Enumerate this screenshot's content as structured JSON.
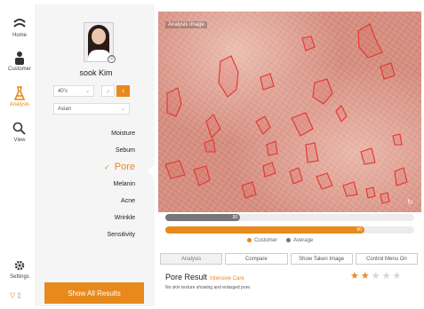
{
  "nav": {
    "items": [
      {
        "label": "Home",
        "icon": "home-icon"
      },
      {
        "label": "Customer",
        "icon": "person-icon"
      },
      {
        "label": "Analysis",
        "icon": "flask-icon",
        "active": true
      },
      {
        "label": "View",
        "icon": "magnifier-icon"
      }
    ],
    "settings_label": "Settings"
  },
  "profile": {
    "name": "sook Kim",
    "age": "40's",
    "ethnicity": "Asian",
    "gender_selected": "female"
  },
  "categories": [
    "Moisture",
    "Sebum",
    "Pore",
    "Melanin",
    "Acne",
    "Wrinkle",
    "Sensitivity"
  ],
  "active_category": "Pore",
  "show_all_label": "Show All Results",
  "image_label": "Analysis Image",
  "scores": {
    "average": 30,
    "customer": 80
  },
  "legend": {
    "customer": "Customer",
    "average": "Average"
  },
  "buttons": [
    "Analysis",
    "Compare",
    "Show Taken Image",
    "Control Menu On"
  ],
  "result": {
    "title": "Pore Result",
    "grade": "Intensive Care",
    "description": "No skin texture showing and enlarged pore.",
    "stars": 2,
    "max_stars": 5
  },
  "colors": {
    "accent": "#e8891c",
    "average_bar": "#777777",
    "pore_outline": "#e3342f"
  }
}
